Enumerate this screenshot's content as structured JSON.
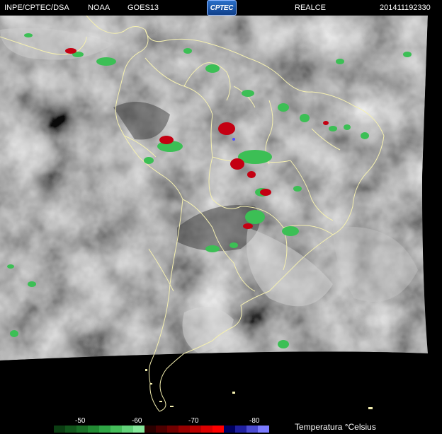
{
  "header": {
    "org": "INPE/CPTEC/DSA",
    "agency": "NOAA",
    "satellite": "GOES13",
    "logo_text": "CPTEC",
    "enhancement": "REALCE",
    "timestamp": "201411192330"
  },
  "legend": {
    "title": "Temperatura  °Celsius",
    "ticks": [
      "-50",
      "-60",
      "-70",
      "-80"
    ],
    "colors": [
      "#0b3d12",
      "#12561c",
      "#1a6e27",
      "#228a33",
      "#2fa545",
      "#45bd5a",
      "#63d27a",
      "#86e89b",
      "#2a0000",
      "#4d0000",
      "#700000",
      "#960000",
      "#b90000",
      "#dc0000",
      "#ff0000",
      "#000060",
      "#2020a0",
      "#4b4bd2",
      "#7a7aff"
    ]
  },
  "colors": {
    "coast": "#f5f0b0",
    "cold_top_green": "#3cbf55",
    "cold_top_red": "#c40012",
    "cloud_gray": "#9a9a9a",
    "space": "#000000"
  }
}
